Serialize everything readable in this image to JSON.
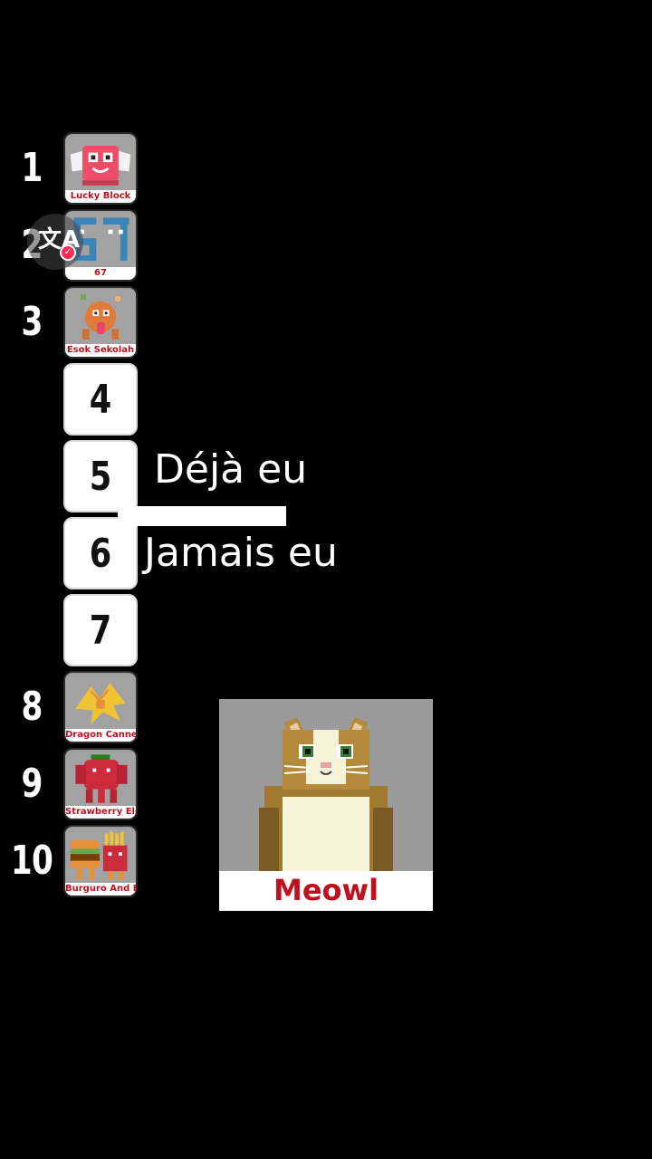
{
  "ranking": {
    "items": [
      {
        "rank": "1",
        "slot_text": "",
        "caption": "Lucky Block",
        "icon": "lucky-block-icon"
      },
      {
        "rank": "2",
        "slot_text": "",
        "caption": "67",
        "icon": "sixty-seven-icon"
      },
      {
        "rank": "3",
        "slot_text": "",
        "caption": "Esok Sekolah",
        "icon": "esok-sekolah-icon"
      },
      {
        "rank": "",
        "slot_text": "4",
        "caption": "",
        "icon": ""
      },
      {
        "rank": "",
        "slot_text": "5",
        "caption": "",
        "icon": ""
      },
      {
        "rank": "",
        "slot_text": "6",
        "caption": "",
        "icon": ""
      },
      {
        "rank": "",
        "slot_text": "7",
        "caption": "",
        "icon": ""
      },
      {
        "rank": "8",
        "slot_text": "",
        "caption": "Dragon Cannelloni",
        "icon": "dragon-cannelloni-icon"
      },
      {
        "rank": "9",
        "slot_text": "",
        "caption": "Strawberry Elephant",
        "icon": "strawberry-elephant-icon"
      },
      {
        "rank": "10",
        "slot_text": "",
        "caption": "Burguro And Fryuro",
        "icon": "burguro-fryuro-icon"
      }
    ]
  },
  "captions": {
    "line1": "Déjà eu",
    "line2": "Jamais eu"
  },
  "translate": {
    "glyph": "文A",
    "check": "✓"
  },
  "candidate_card": {
    "label": "Meowl",
    "icon": "meowl-cat-icon"
  },
  "colors": {
    "background": "#000000",
    "caption_red": "#c0101e",
    "badge_pink": "#fe2c55",
    "slot_white": "#ffffff"
  }
}
